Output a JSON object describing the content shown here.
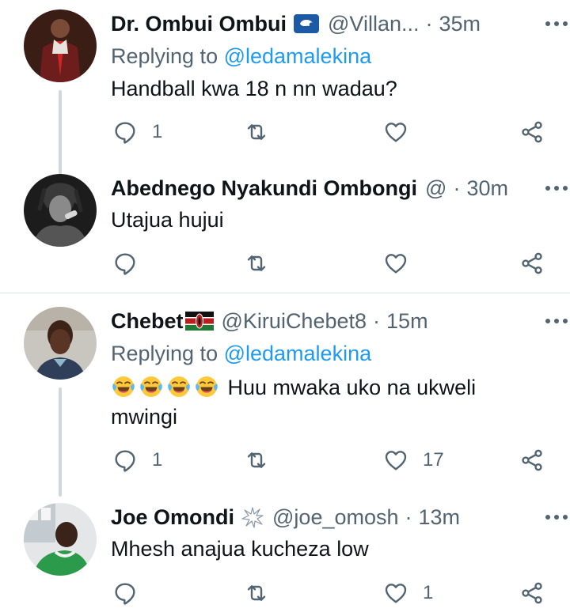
{
  "tweets": [
    {
      "name": "Dr. Ombui Ombui",
      "handle": "@Villan...",
      "time": "35m",
      "replying_prefix": "Replying to ",
      "replying_to": "@ledamalekina",
      "text": "Handball kwa 18 n nn wadau?",
      "reply_count": "1",
      "retweet_count": "",
      "like_count": ""
    },
    {
      "name": "Abednego Nyakundi Ombongi",
      "handle": "@",
      "time": "30m",
      "text": "Utajua  hujui",
      "reply_count": "",
      "retweet_count": "",
      "like_count": ""
    },
    {
      "name": "Chebet",
      "handle": "@KiruiChebet8",
      "time": "15m",
      "replying_prefix": "Replying to ",
      "replying_to": "@ledamalekina",
      "text_line1": " Huu mwaka uko na ukweli",
      "text_line2": "mwingi",
      "emojis": [
        "face-with-tears-of-joy",
        "face-with-tears-of-joy",
        "face-with-tears-of-joy",
        "face-with-tears-of-joy"
      ],
      "reply_count": "1",
      "retweet_count": "",
      "like_count": "17"
    },
    {
      "name": "Joe Omondi",
      "handle": "@joe_omosh",
      "time": "13m",
      "text": "Mhesh anajua kucheza low",
      "reply_count": "",
      "retweet_count": "",
      "like_count": "1"
    }
  ],
  "separator": "·",
  "icons": {
    "reply": "reply-icon",
    "retweet": "retweet-icon",
    "like": "heart-icon",
    "share": "share-icon",
    "more": "more-options-icon"
  },
  "colors": {
    "text": "#0f1419",
    "secondary": "#536471",
    "accent": "#1d9bf0",
    "thread_line": "#cfd9de"
  }
}
